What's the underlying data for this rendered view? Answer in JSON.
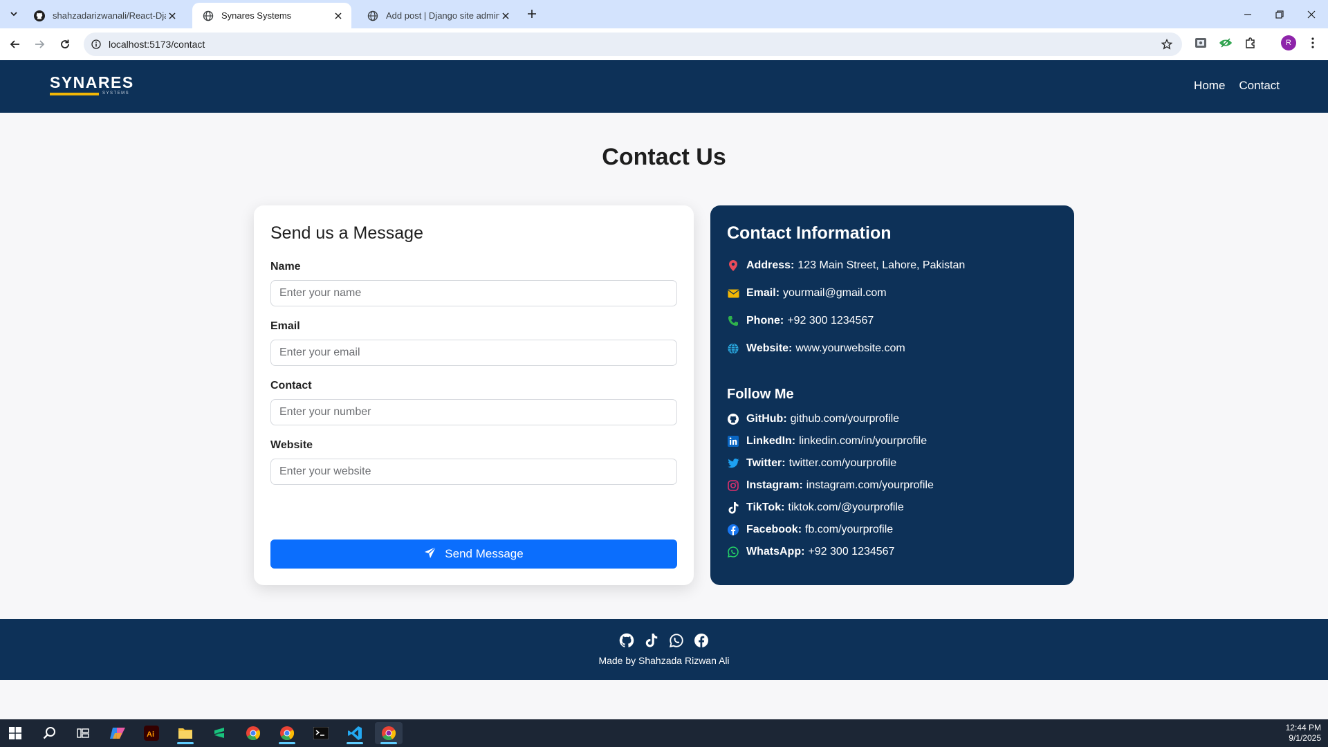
{
  "browser": {
    "tabs": [
      {
        "title": "shahzadarizwanali/React-Djang",
        "active": false
      },
      {
        "title": "Synares Systems",
        "active": true
      },
      {
        "title": "Add post | Django site admin",
        "active": false
      }
    ],
    "url": "localhost:5173/contact",
    "profile_initial": "R"
  },
  "header": {
    "logo_word": "SYNARES",
    "logo_sub": "SYSTEMS",
    "nav": [
      "Home",
      "Contact"
    ]
  },
  "page": {
    "title": "Contact Us"
  },
  "form": {
    "heading": "Send us a Message",
    "fields": [
      {
        "label": "Name",
        "placeholder": "Enter your name"
      },
      {
        "label": "Email",
        "placeholder": "Enter your email"
      },
      {
        "label": "Contact",
        "placeholder": "Enter your number"
      },
      {
        "label": "Website",
        "placeholder": "Enter your website"
      }
    ],
    "submit_label": "Send Message"
  },
  "contact_info": {
    "heading": "Contact Information",
    "items": [
      {
        "label": "Address:",
        "value": "123 Main Street, Lahore, Pakistan",
        "icon": "location-pin-icon",
        "color": "#e84b5a"
      },
      {
        "label": "Email:",
        "value": "yourmail@gmail.com",
        "icon": "envelope-icon",
        "color": "#f2b705"
      },
      {
        "label": "Phone:",
        "value": "+92 300 1234567",
        "icon": "phone-icon",
        "color": "#2fb24c"
      },
      {
        "label": "Website:",
        "value": "www.yourwebsite.com",
        "icon": "globe-icon",
        "color": "#29a8df"
      }
    ],
    "follow_heading": "Follow Me",
    "socials": [
      {
        "label": "GitHub:",
        "value": "github.com/yourprofile",
        "icon": "github-icon",
        "color": "#ffffff"
      },
      {
        "label": "LinkedIn:",
        "value": "linkedin.com/in/yourprofile",
        "icon": "linkedin-icon",
        "color": "#0a66c2"
      },
      {
        "label": "Twitter:",
        "value": "twitter.com/yourprofile",
        "icon": "twitter-icon",
        "color": "#1da1f2"
      },
      {
        "label": "Instagram:",
        "value": "instagram.com/yourprofile",
        "icon": "instagram-icon",
        "color": "#e1306c"
      },
      {
        "label": "TikTok:",
        "value": "tiktok.com/@yourprofile",
        "icon": "tiktok-icon",
        "color": "#ffffff"
      },
      {
        "label": "Facebook:",
        "value": "fb.com/yourprofile",
        "icon": "facebook-icon",
        "color": "#1877f2"
      },
      {
        "label": "WhatsApp:",
        "value": "+92 300 1234567",
        "icon": "whatsapp-icon",
        "color": "#25d366"
      }
    ]
  },
  "footer": {
    "icons": [
      "github-icon",
      "tiktok-icon",
      "whatsapp-icon",
      "facebook-icon"
    ],
    "text": "Made by Shahzada Rizwan Ali"
  },
  "taskbar": {
    "time": "12:44 PM",
    "date": "9/1/2025"
  }
}
